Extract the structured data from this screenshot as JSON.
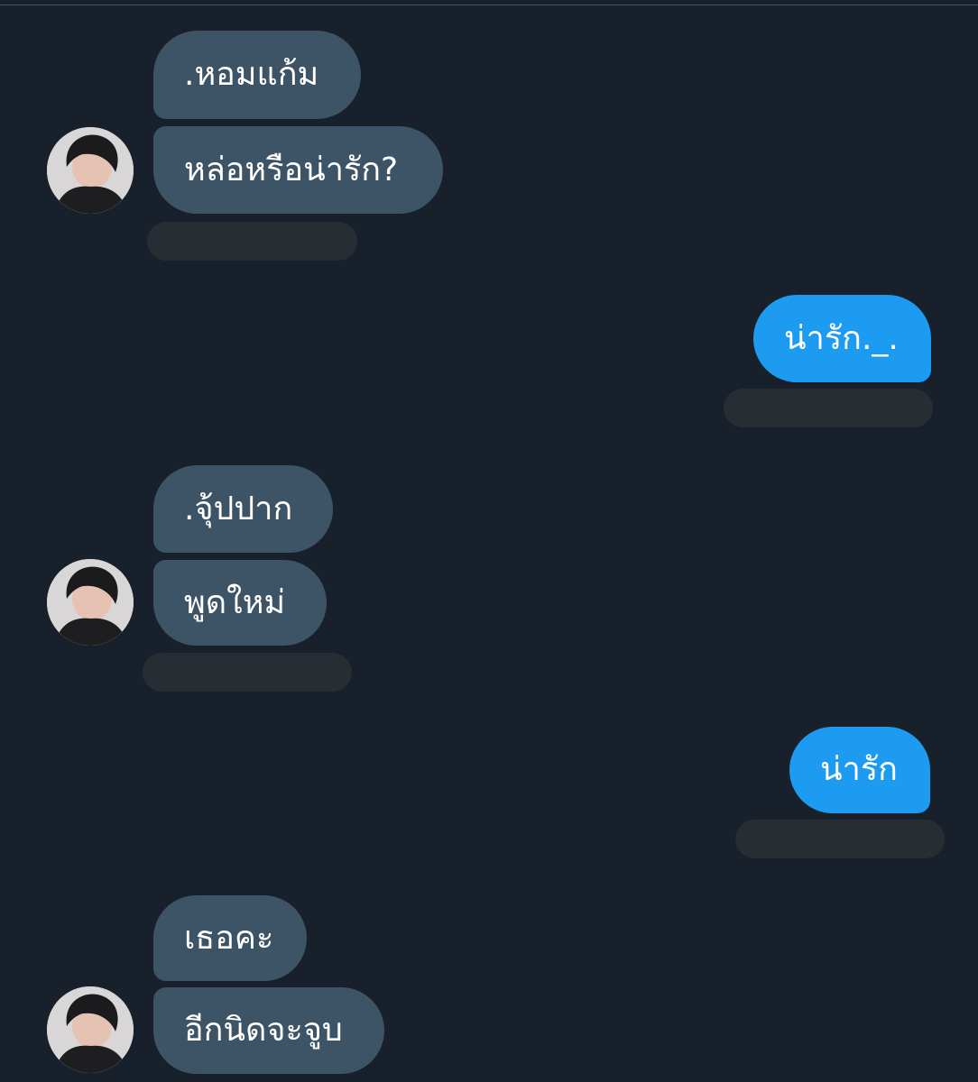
{
  "conversation": {
    "messages": [
      {
        "id": "m1",
        "direction": "incoming",
        "text": ".หอมแก้ม"
      },
      {
        "id": "m2",
        "direction": "incoming",
        "text": "หล่อหรือน่ารัก?"
      },
      {
        "id": "m3",
        "direction": "outgoing",
        "text": "น่ารัก._."
      },
      {
        "id": "m4",
        "direction": "incoming",
        "text": ".จุ้ปปาก"
      },
      {
        "id": "m5",
        "direction": "incoming",
        "text": "พูดใหม่"
      },
      {
        "id": "m6",
        "direction": "outgoing",
        "text": "น่ารัก"
      },
      {
        "id": "m7",
        "direction": "incoming",
        "text": "เธอคะ"
      },
      {
        "id": "m8",
        "direction": "incoming",
        "text": "อีกนิดจะจูบ"
      }
    ]
  },
  "colors": {
    "background": "#17202b",
    "incoming_bubble": "#3d5466",
    "outgoing_bubble": "#1d9bf0",
    "redacted_bar": "#282d33"
  }
}
